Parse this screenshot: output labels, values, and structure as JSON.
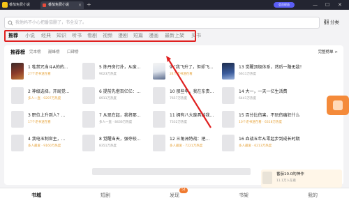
{
  "window": {
    "app_name": "番茄免费小说",
    "tab_title": "番茄免费小说",
    "tab_close": "×",
    "tab_add": "+",
    "pill_text": "会员权益",
    "controls": [
      "—",
      "☐",
      "✕"
    ]
  },
  "search": {
    "placeholder": "我他妈不小心把番茄删了，书全没了。"
  },
  "category_button": {
    "label": "分类"
  },
  "nav": {
    "items": [
      "推荐",
      "小说",
      "经典",
      "知识",
      "听书",
      "看剧",
      "视频",
      "漫剧",
      "短篇",
      "漫画",
      "最新上架",
      "买书"
    ],
    "active": "推荐"
  },
  "panel": {
    "title": "推荐榜",
    "subtabs": [
      "完本榜",
      "巅峰榜",
      "口碑榜"
    ],
    "more": "完整榜单 >"
  },
  "books": [
    {
      "title": "1 牲禁咒当斗A的的...",
      "meta": "27个老书迷在看"
    },
    {
      "title": "2 神级选择，开局觉...",
      "meta": "多人一直 · 9297万热度"
    },
    {
      "title": "3 职位上升到人？...",
      "meta": "17个老书迷在看"
    },
    {
      "title": "4 我电玉制官主，...",
      "meta": "多人最爱 · 9160万热度"
    },
    {
      "title": "5 炼丹房打扑，从废...",
      "meta": "9023万热度"
    },
    {
      "title": "6 提前先借百亿亿：...",
      "meta": "8911万热度"
    },
    {
      "title": "7 从现在起，我将那...",
      "meta": "多人一直 · 8436万热度"
    },
    {
      "title": "8 觉醒当天，强夺校...",
      "meta": "8351万热度"
    },
    {
      "title": "9 “我飞升了，但却飞...",
      "meta": "24个老书迷在看"
    },
    {
      "title": "10 那些年，我在东贵...",
      "meta": "7657万热度"
    },
    {
      "title": "11 拥有八大废具的我...",
      "meta": "7332万热度"
    },
    {
      "title": "12 三角洲特战：把...",
      "meta": "多人最爱 · 7221万热度"
    },
    {
      "title": "13 觉醒顶级体系，然后一路无敌！",
      "meta": "6611万热度"
    },
    {
      "title": "14 大一，一天一亿生活费",
      "meta": "6441万热度"
    },
    {
      "title": "15 百分比伤害，不玩伤痛狂什么",
      "meta": "10个老书迷在看 · 6318万热度"
    },
    {
      "title": "16 血战五年从零起步到成长时期",
      "meta": "多人最爱 · 6213万热度"
    }
  ],
  "floating_card": {
    "title": "番茄10.0的神作",
    "sub": "11.1万人在看"
  },
  "bottom_nav": {
    "items": [
      "书城",
      "短剧",
      "发现",
      "书架",
      "我的"
    ],
    "active": "书城",
    "badge": "54"
  },
  "colors": {
    "accent": "#e02020",
    "highlight": "#e5a23a",
    "ad": "#f48a3a"
  }
}
